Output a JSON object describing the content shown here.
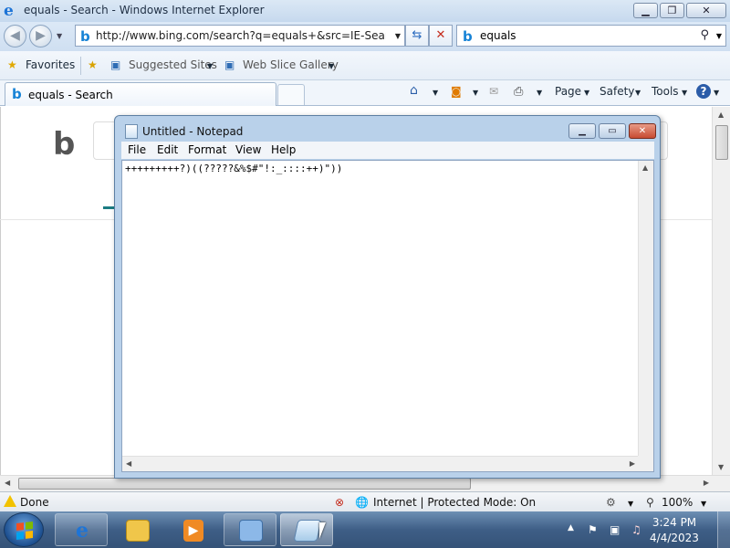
{
  "ie": {
    "window_title": "equals - Search - Windows Internet Explorer",
    "address": "http://www.bing.com/search?q=equals+&src=IE-SearchBox",
    "search_value": "equals",
    "favorites_label": "Favorites",
    "suggested_sites": "Suggested Sites",
    "web_slice_gallery": "Web Slice Gallery",
    "tab_label": "equals - Search",
    "cmd_page": "Page",
    "cmd_safety": "Safety",
    "cmd_tools": "Tools",
    "status_done": "Done",
    "status_zone": "Internet | Protected Mode: On",
    "zoom": "100%"
  },
  "notepad": {
    "title": "Untitled - Notepad",
    "menu": [
      "File",
      "Edit",
      "Format",
      "View",
      "Help"
    ],
    "text": "+++++++++?)((?????&%$#\"!:_::::++)\"))"
  },
  "taskbar": {
    "time": "3:24 PM",
    "date": "4/4/2023"
  }
}
